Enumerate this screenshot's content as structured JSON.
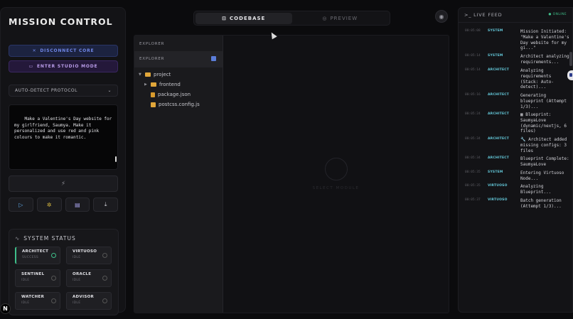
{
  "left": {
    "title": "MISSION CONTROL",
    "disconnect_label": "DISCONNECT CORE",
    "studio_label": "ENTER STUDIO MODE",
    "protocol_value": "AUTO-DETECT PROTOCOL",
    "prompt_text": "Make a Valentine's Day website for my girlfriend, Saumya. Make it personalized and use red and pink colours to make it romantic.",
    "run_icon": "lightning-icon",
    "tools": [
      "play-icon",
      "bug-icon",
      "document-icon",
      "download-icon"
    ],
    "status_title": "SYSTEM STATUS",
    "agents": [
      {
        "name": "ARCHITECT",
        "state": "SUCCESS"
      },
      {
        "name": "VIRTUOSO",
        "state": "IDLE"
      },
      {
        "name": "SENTINEL",
        "state": "IDLE"
      },
      {
        "name": "ORACLE",
        "state": "IDLE"
      },
      {
        "name": "WATCHER",
        "state": "IDLE"
      },
      {
        "name": "ADVISOR",
        "state": "IDLE"
      }
    ],
    "badge": "N"
  },
  "tabs": [
    {
      "label": "CODEBASE",
      "active": true
    },
    {
      "label": "PREVIEW",
      "active": false
    }
  ],
  "explorer": {
    "header": "EXPLORER",
    "subheader": "EXPLORER",
    "tree": [
      {
        "label": "project",
        "type": "folder"
      },
      {
        "label": "frontend",
        "type": "folder"
      },
      {
        "label": "package.json",
        "type": "file"
      },
      {
        "label": "postcss.config.js",
        "type": "file"
      }
    ],
    "empty_text": "SELECT MODULE"
  },
  "feed": {
    "title": "LIVE FEED",
    "status": "ONLINE",
    "logs": [
      {
        "time": "00:05:08",
        "source": "SYSTEM",
        "message": "Mission Initiated: \"Make a Valentine's Day website for my gi...\""
      },
      {
        "time": "00:05:14",
        "source": "SYSTEM",
        "message": "Architect analyzing requirements..."
      },
      {
        "time": "00:05:14",
        "source": "ARCHITECT",
        "message": "Analyzing requirements (Stack: Auto-detect)..."
      },
      {
        "time": "00:05:16",
        "source": "ARCHITECT",
        "message": "Generating blueprint (Attempt 1/3)..."
      },
      {
        "time": "00:05:24",
        "source": "ARCHITECT",
        "message": "▦ Blueprint: SaumyaLove (dynamic/nextjs, 6 files)"
      },
      {
        "time": "00:05:34",
        "source": "ARCHITECT",
        "message": "🔧 Architect added missing configs: 3 files"
      },
      {
        "time": "00:05:34",
        "source": "ARCHITECT",
        "message": "Blueprint Complete: SaumyaLove"
      },
      {
        "time": "00:05:35",
        "source": "SYSTEM",
        "message": "Entering Virtuoso Node..."
      },
      {
        "time": "00:05:35",
        "source": "VIRTUOSO",
        "message": "Analyzing Blueprint..."
      },
      {
        "time": "00:05:37",
        "source": "VIRTUOSO",
        "message": "Batch generation (Attempt 1/3)..."
      }
    ]
  }
}
